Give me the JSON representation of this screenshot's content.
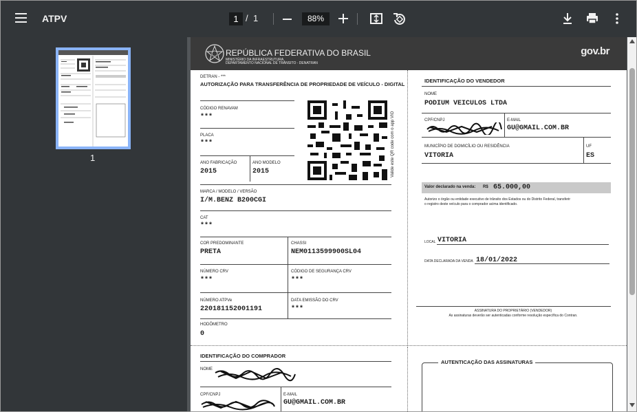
{
  "toolbar": {
    "title": "ATPV",
    "current_page": "1",
    "slash": "/",
    "total_pages": "1",
    "zoom": "88%"
  },
  "sidebar": {
    "thumb_number": "1"
  },
  "doc": {
    "header_title": "REPÚBLICA FEDERATIVA DO BRASIL",
    "header_sub1": "MINISTÉRIO DA INFRAESTRUTURA",
    "header_sub2": "DEPARTAMENTO NACIONAL DE TRÂNSITO - DENATRAN",
    "govbr": "gov.br",
    "detran": "DETRAN - ***",
    "form_title": "AUTORIZAÇÃO PARA TRANSFERÊNCIA DE PROPRIEDADE DE VEÍCULO - DIGITAL",
    "renavam_label": "CÓDIGO RENAVAM",
    "renavam_value": "***",
    "placa_label": "PLACA",
    "placa_value": "***",
    "ano_fab_label": "ANO FABRICAÇÃO",
    "ano_fab_value": "2015",
    "ano_mod_label": "ANO MODELO",
    "ano_mod_value": "2015",
    "qr_side_text": "Valide este QR code com o app VIO",
    "marca_label": "MARCA / MODELO / VERSÃO",
    "marca_value": "I/M.BENZ B200CGI",
    "cat_label": "CAT",
    "cat_value": "***",
    "cor_label": "COR PREDOMINANTE",
    "cor_value": "PRETA",
    "chassi_label": "CHASSI",
    "chassi_value": "NEM0113599900SL04",
    "crv_label": "NÚMERO CRV",
    "crv_value": "***",
    "seg_crv_label": "CÓDIGO DE SEGURANÇA CRV",
    "seg_crv_value": "***",
    "atpve_label": "NÚMERO ATPVe",
    "atpve_value": "220181152001191",
    "emissao_label": "DATA EMISSÃO DO CRV",
    "emissao_value": "***",
    "hodometro_label": "HODÔMETRO",
    "hodometro_value": "0",
    "vendedor_title": "IDENTIFICAÇÃO DO VENDEDOR",
    "nome_label": "NOME",
    "vendedor_nome": "PODIUM VEICULOS LTDA",
    "cpf_label": "CPF/CNPJ",
    "email_label": "E-MAIL",
    "vendedor_email": "GU@GMAIL.COM.BR",
    "municipio_label": "MUNICÍPIO DE DOMICÍLIO OU RESIDÊNCIA",
    "municipio_value": "VITORIA",
    "uf_label": "UF",
    "uf_value": "ES",
    "valor_label": "Valor declarado na venda:",
    "valor_currency": "R$",
    "valor_value": "65.000,00",
    "autorizo_1": "Autorizo o órgão ou entidade executivo de trânsito dos Estados ou do Distrito Federal, transferir",
    "autorizo_2": "o registro deste veículo para o comprador acima identificado.",
    "local_label": "LOCAL",
    "local_value": "VITORIA",
    "data_label": "DATA DECLARADA DA VENDA",
    "data_value": "18/01/2022",
    "assinatura_1": "ASSINATURA DO PROPRIETÁRIO (VENDEDOR)",
    "assinatura_2": "As assinaturas deverão ser autenticadas conforme resolução específica do Contran.",
    "comprador_title": "IDENTIFICAÇÃO DO COMPRADOR",
    "comprador_nome_label": "NOME",
    "comprador_cpf_label": "CPF/CNPJ",
    "comprador_email_label": "E-MAIL",
    "comprador_email": "GU@GMAIL.COM.BR",
    "autenticacao_title": "AUTENTICAÇÃO DAS ASSINATURAS"
  }
}
